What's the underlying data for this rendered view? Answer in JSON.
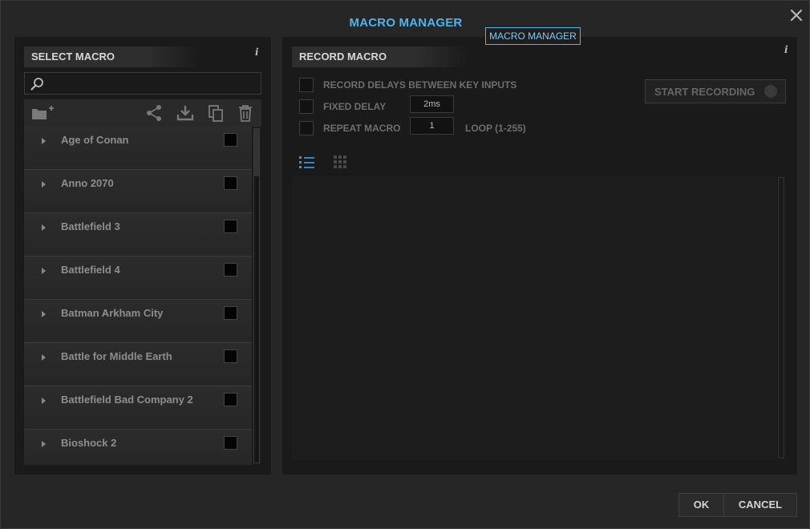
{
  "window": {
    "title": "MACRO MANAGER",
    "tooltip": "MACRO MANAGER"
  },
  "select_macro": {
    "header": "SELECT MACRO",
    "info": "i",
    "search": {
      "value": "",
      "placeholder": ""
    },
    "toolbar": {
      "icons": [
        "new-folder-icon",
        "share-icon",
        "download-icon",
        "copy-icon",
        "trash-icon"
      ]
    },
    "items": [
      {
        "label": "Age of Conan",
        "checked": false
      },
      {
        "label": "Anno 2070",
        "checked": false
      },
      {
        "label": "Battlefield 3",
        "checked": false
      },
      {
        "label": "Battlefield 4",
        "checked": false
      },
      {
        "label": "Batman Arkham City",
        "checked": false
      },
      {
        "label": "Battle for Middle Earth",
        "checked": false
      },
      {
        "label": "Battlefield Bad Company 2",
        "checked": false
      },
      {
        "label": "Bioshock 2",
        "checked": false
      }
    ]
  },
  "record_macro": {
    "header": "RECORD MACRO",
    "info": "i",
    "options": {
      "record_delays": {
        "label": "RECORD DELAYS BETWEEN KEY INPUTS",
        "checked": false
      },
      "fixed_delay": {
        "label": "FIXED DELAY",
        "checked": false,
        "value": "2ms"
      },
      "repeat_macro": {
        "label": "REPEAT MACRO",
        "checked": false,
        "value": "1",
        "suffix": "LOOP (1-255)"
      }
    },
    "start_recording": "START RECORDING",
    "view_tabs": [
      "list-view-icon",
      "grid-view-icon"
    ],
    "active_view": "list"
  },
  "footer": {
    "ok": "OK",
    "cancel": "CANCEL"
  },
  "colors": {
    "accent": "#4fb4ec",
    "background": "#262626",
    "panel": "#1a1a1a"
  }
}
